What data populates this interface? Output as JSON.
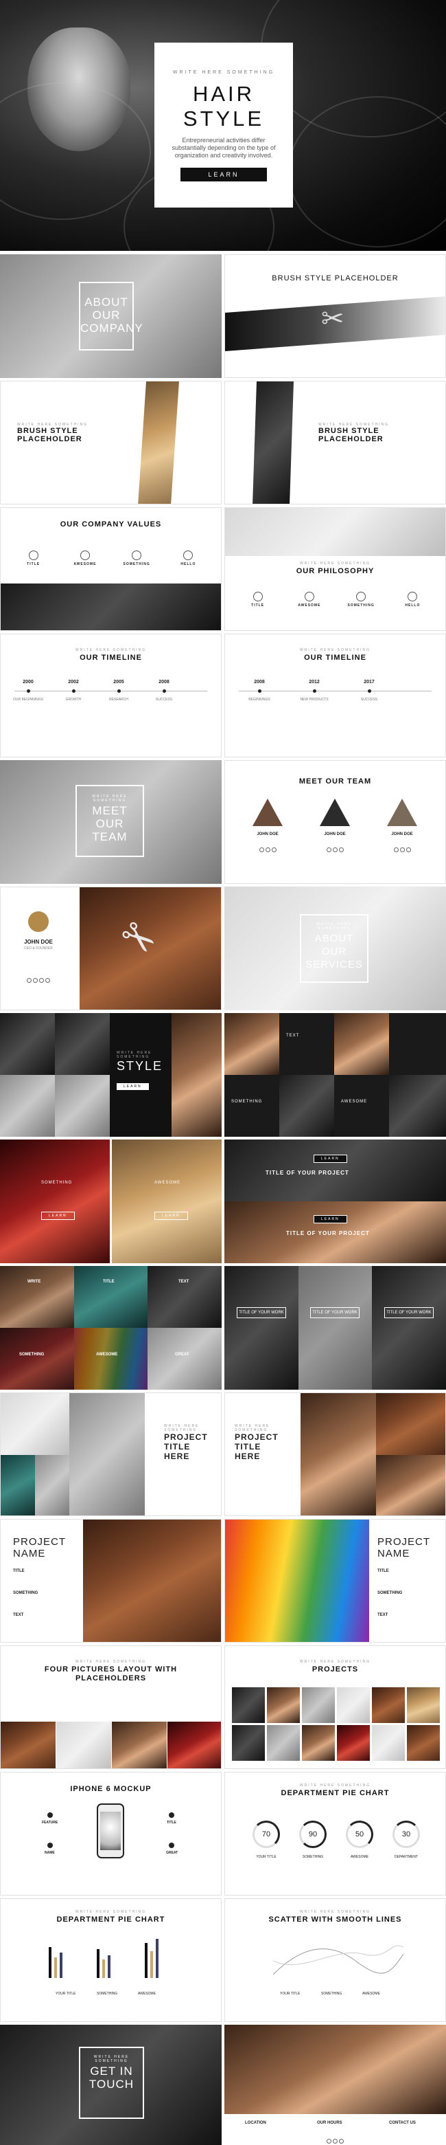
{
  "hero": {
    "kicker": "WRITE HERE SOMETHING",
    "title_line1": "HAIR",
    "title_line2": "STYLE",
    "subtitle": "Entrepreneurial activities differ substantially depending on the type of organization and creativity involved.",
    "button": "LEARN"
  },
  "slides": {
    "about_company": {
      "title": "ABOUT OUR COMPANY"
    },
    "brush1": {
      "title": "BRUSH STYLE PLACEHOLDER"
    },
    "brush2": {
      "kicker": "WRITE HERE SOMETHING",
      "title": "BRUSH STYLE PLACEHOLDER"
    },
    "brush3": {
      "kicker": "WRITE HERE SOMETHING",
      "title": "BRUSH STYLE PLACEHOLDER"
    },
    "values": {
      "title": "OUR COMPANY VALUES",
      "items": [
        "TITLE",
        "AWESOME",
        "SOMETHING",
        "HELLO"
      ]
    },
    "philosophy": {
      "kicker": "WRITE HERE SOMETHING",
      "title": "OUR PHILOSOPHY",
      "items": [
        "TITLE",
        "AWESOME",
        "SOMETHING",
        "HELLO"
      ]
    },
    "timeline1": {
      "kicker": "WRITE HERE SOMETHING",
      "title": "OUR TIMELINE",
      "years": [
        "2000",
        "2002",
        "2005",
        "2008"
      ],
      "labels": [
        "OUR BEGINNINGS",
        "GROWTH",
        "RESEARCH",
        "SUCCESS"
      ]
    },
    "timeline2": {
      "kicker": "WRITE HERE SOMETHING",
      "title": "OUR TIMELINE",
      "years": [
        "2008",
        "2012",
        "2017"
      ],
      "labels": [
        "BEGINNINGS",
        "NEW PRODUCTS",
        "SUCCESS"
      ]
    },
    "meet_team": {
      "kicker": "WRITE HERE SOMETHING",
      "title": "MEET OUR TEAM"
    },
    "team": {
      "title": "MEET OUR TEAM",
      "members": [
        "JOHN DOE",
        "JOHN DOE",
        "JOHN DOE"
      ]
    },
    "profile": {
      "name": "JOHN DOE",
      "role": "CEO & FOUNDER"
    },
    "services": {
      "kicker": "WRITE HERE SOMETHING",
      "title": "ABOUT OUR SERVICES"
    },
    "style": {
      "kicker": "WRITE HERE SOMETHING",
      "title": "STYLE",
      "button": "LEARN"
    },
    "grid_text": {
      "labels": [
        "TEXT",
        "SOMETHING",
        "AWESOME"
      ]
    },
    "red": {
      "labels": [
        "SOMETHING",
        "AWESOME"
      ],
      "buttons": [
        "LEARN",
        "LEARN"
      ]
    },
    "project_band": {
      "buttons": [
        "LEARN",
        "LEARN"
      ],
      "titles": [
        "TITLE OF YOUR PROJECT",
        "TITLE OF YOUR PROJECT"
      ]
    },
    "color_grid": {
      "labels": [
        "WRITE",
        "TITLE",
        "TEXT",
        "SOMETHING",
        "AWESOME",
        "GREAT"
      ]
    },
    "work": {
      "titles": [
        "TITLE OF YOUR WORK",
        "TITLE OF YOUR WORK",
        "TITLE OF YOUR WORK"
      ]
    },
    "project_title1": {
      "kicker": "WRITE HERE SOMETHING",
      "title": "PROJECT TITLE HERE"
    },
    "project_title2": {
      "kicker": "WRITE HERE SOMETHING",
      "title": "PROJECT TITLE HERE"
    },
    "project_name1": {
      "title": "PROJECT NAME",
      "items": [
        "TITLE",
        "SOMETHING",
        "TEXT"
      ]
    },
    "project_name2": {
      "title": "PROJECT NAME",
      "items": [
        "TITLE",
        "SOMETHING",
        "TEXT"
      ]
    },
    "four_pictures": {
      "kicker": "WRITE HERE SOMETHING",
      "title": "FOUR PICTURES LAYOUT WITH PLACEHOLDERS"
    },
    "projects": {
      "kicker": "WRITE HERE SOMETHING",
      "title": "PROJECTS"
    },
    "iphone": {
      "title": "IPHONE 6 MOCKUP",
      "items": [
        "FEATURE",
        "TITLE",
        "NAME",
        "GREAT"
      ]
    },
    "pie": {
      "kicker": "WRITE HERE SOMETHING",
      "title": "DEPARTMENT PIE CHART",
      "values": [
        "70",
        "90",
        "50",
        "30"
      ],
      "labels": [
        "YOUR TITLE",
        "SOMETHING",
        "AWESOME",
        "DEPARTMENT"
      ]
    },
    "bars": {
      "kicker": "WRITE HERE SOMETHING",
      "title": "DEPARTMENT PIE CHART",
      "legend": [
        "YOUR TITLE",
        "SOMETHING",
        "AWESOME"
      ]
    },
    "scatter": {
      "kicker": "WRITE HERE SOMETHING",
      "title": "SCATTER WITH SMOOTH LINES",
      "legend": [
        "YOUR TITLE",
        "SOMETHING",
        "AWESOME"
      ]
    },
    "touch": {
      "kicker": "WRITE HERE SOMETHING",
      "title": "GET IN TOUCH"
    },
    "contact": {
      "labels": [
        "LOCATION",
        "OUR HOURS",
        "CONTACT US"
      ]
    }
  },
  "colors": {
    "accent": "#111111",
    "bar_gold": "#c9a86a",
    "bar_navy": "#3b4066"
  }
}
